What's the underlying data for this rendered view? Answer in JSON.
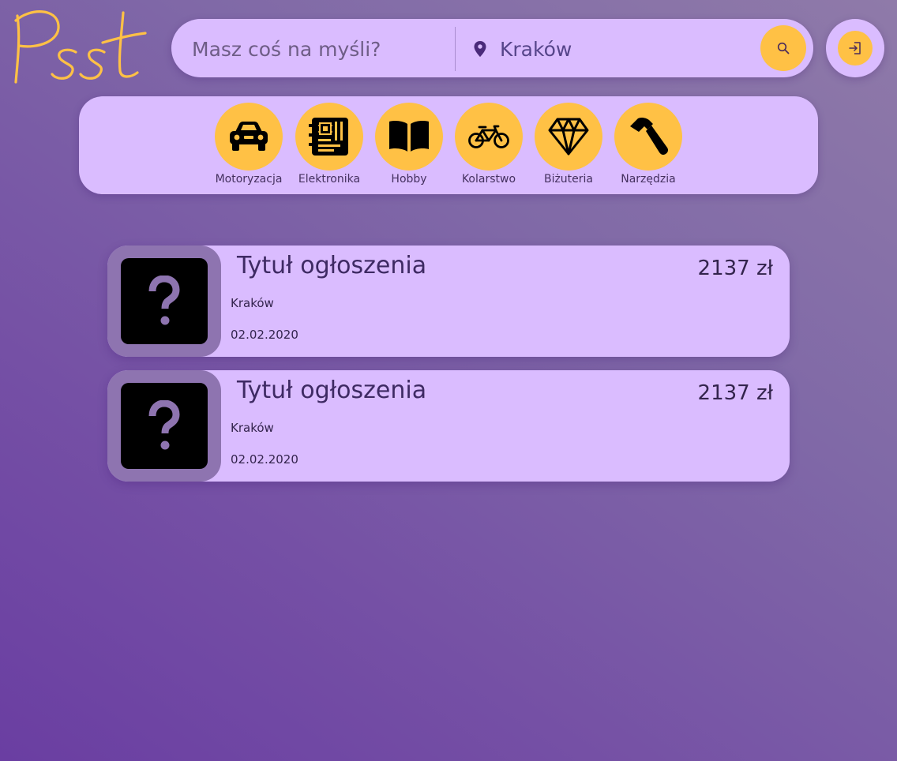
{
  "header": {
    "search": {
      "placeholder": "Masz coś na myśli?"
    },
    "location": {
      "value": "Kraków",
      "icon": "map-pin-icon"
    },
    "search_button": {
      "icon": "search-icon"
    },
    "login_button": {
      "icon": "login-icon"
    }
  },
  "categories": [
    {
      "label": "Motoryzacja",
      "icon": "car-icon"
    },
    {
      "label": "Elektronika",
      "icon": "circuit-board-icon"
    },
    {
      "label": "Hobby",
      "icon": "book-icon"
    },
    {
      "label": "Kolarstwo",
      "icon": "bicycle-icon"
    },
    {
      "label": "Biżuteria",
      "icon": "diamond-icon"
    },
    {
      "label": "Narzędzia",
      "icon": "hammer-icon"
    }
  ],
  "listings": [
    {
      "title": "Tytuł ogłoszenia",
      "price": "2137 zł",
      "location": "Kraków",
      "date": "02.02.2020",
      "image": "placeholder-question-icon"
    },
    {
      "title": "Tytuł ogłoszenia",
      "price": "2137 zł",
      "location": "Kraków",
      "date": "02.02.2020",
      "image": "placeholder-question-icon"
    }
  ],
  "colors": {
    "accent": "#ffc145",
    "panel": "#dabcff",
    "thumb": "#8e74b0"
  }
}
